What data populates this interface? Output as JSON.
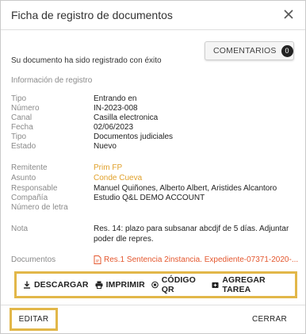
{
  "modal": {
    "title": "Ficha de registro de documentos",
    "comments_label": "COMENTARIOS",
    "comments_count": "0",
    "success_message": "Su documento ha sido registrado con éxito",
    "section_title": "Información de registro"
  },
  "fields": [
    {
      "label": "Tipo",
      "value": "Entrando en"
    },
    {
      "label": "Número",
      "value": "IN-2023-008"
    },
    {
      "label": "Canal",
      "value": "Casilla electronica"
    },
    {
      "label": "Fecha",
      "value": "02/06/2023"
    },
    {
      "label": "Tipo",
      "value": "Documentos judiciales"
    },
    {
      "label": "Estado",
      "value": "Nuevo"
    },
    {
      "label": "Remitente",
      "value": "Prim FP"
    },
    {
      "label": "Asunto",
      "value": "Conde Cueva"
    },
    {
      "label": "Responsable",
      "value": "Manuel Quiñones, Alberto Albert, Aristides Alcantoro"
    },
    {
      "label": "Compañía",
      "value": "Estudio Q&L DEMO ACCOUNT"
    },
    {
      "label": "Número de letra",
      "value": ""
    }
  ],
  "nota": {
    "label": "Nota",
    "value": "Res. 14: plazo para subsanar abcdjf de 5 días. Adjuntar poder dle repres."
  },
  "documentos": {
    "label": "Documentos",
    "value": "Res.1 Sentencia 2instancia. Expediente-07371-2020-..."
  },
  "actions": {
    "download": "DESCARGAR",
    "print": "IMPRIMIR",
    "qr": "CÓDIGO QR",
    "add_task": "AGREGAR TAREA"
  },
  "footer": {
    "edit": "EDITAR",
    "close": "CERRAR"
  },
  "colors": {
    "accent": "#e2b749",
    "link": "#e0a02a",
    "doc_link": "#e4572e"
  }
}
